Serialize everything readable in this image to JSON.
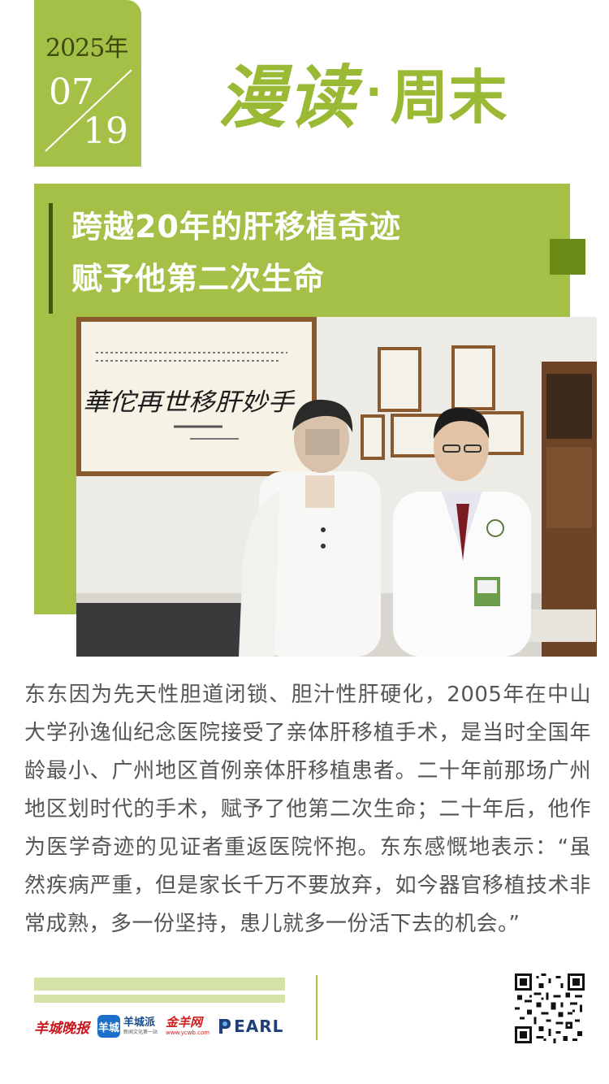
{
  "header": {
    "year": "2025年",
    "month": "07",
    "day": "19",
    "brand_main": "漫读",
    "brand_dot": "·",
    "brand_sub": "周末"
  },
  "article": {
    "title_line1": "跨越20年的肝移植奇迹",
    "title_line2": "赋予他第二次生命",
    "body": "东东因为先天性胆道闭锁、胆汁性肝硬化，2005年在中山大学孙逸仙纪念医院接受了亲体肝移植手术，是当时全国年龄最小、广州地区首例亲体肝移植患者。二十年前那场广州地区划时代的手术，赋予了他第二次生命；二十年后，他作为医学奇迹的见证者重返医院怀抱。东东感慨地表示：“虽然疾病严重，但是家长千万不要放弃，如今器官移植技术非常成熟，多一份坚持，患儿就多一份活下去的机会。”"
  },
  "photo": {
    "calligraphy": "華佗再世移肝妙手"
  },
  "footer": {
    "logo_ycwb": "羊城晚报",
    "logo_ycp_icon": "羊城",
    "logo_ycp_name": "羊城派",
    "logo_ycp_slogan": "新闻文化第一站",
    "logo_jyw_name": "金羊网",
    "logo_jyw_url": "www.ycwb.com",
    "logo_pearl": "EARL"
  },
  "colors": {
    "accent_green": "#a4c046",
    "dark_green": "#6a8a16",
    "brand_green": "#9ab934",
    "body_text": "#555555"
  },
  "icons": [
    "pearl-logo-icon",
    "qr-code-icon"
  ]
}
